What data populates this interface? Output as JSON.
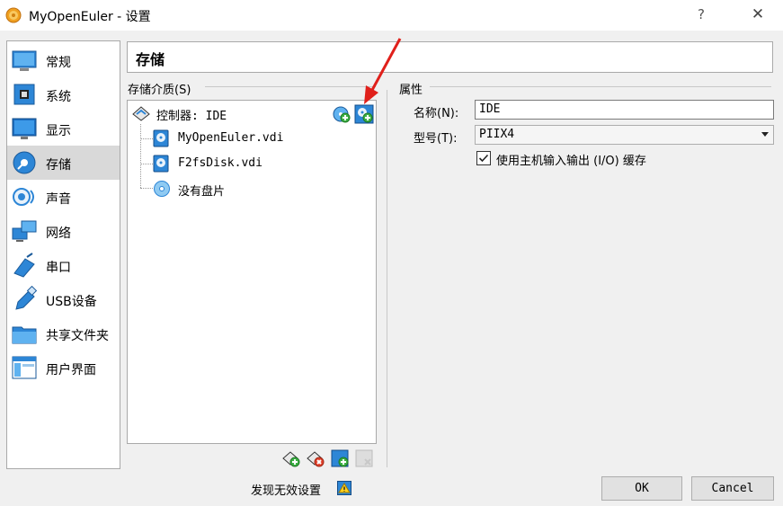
{
  "window": {
    "title": "MyOpenEuler - 设置",
    "help": "?",
    "close": "✕"
  },
  "sidebar": {
    "items": [
      {
        "label": "常规",
        "icon": "general-icon"
      },
      {
        "label": "系统",
        "icon": "system-chip-icon"
      },
      {
        "label": "显示",
        "icon": "display-monitor-icon"
      },
      {
        "label": "存储",
        "icon": "storage-disk-icon",
        "selected": true
      },
      {
        "label": "声音",
        "icon": "sound-speaker-icon"
      },
      {
        "label": "网络",
        "icon": "network-icon"
      },
      {
        "label": "串口",
        "icon": "serial-port-icon"
      },
      {
        "label": "USB设备",
        "icon": "usb-icon"
      },
      {
        "label": "共享文件夹",
        "icon": "shared-folder-icon"
      },
      {
        "label": "用户界面",
        "icon": "user-interface-icon"
      }
    ]
  },
  "header": {
    "title": "存储"
  },
  "storage": {
    "section_label": "存储介质(S)",
    "tree": {
      "controller": "控制器: IDE",
      "children": [
        {
          "label": "MyOpenEuler.vdi",
          "icon": "hard-disk-icon"
        },
        {
          "label": "F2fsDisk.vdi",
          "icon": "hard-disk-icon"
        },
        {
          "label": "没有盘片",
          "icon": "optical-disc-icon"
        }
      ]
    },
    "controller_actions": [
      "add-optical-drive-icon",
      "add-hard-disk-icon"
    ],
    "bottom_actions": [
      "add-controller-icon",
      "remove-controller-icon",
      "add-attachment-icon",
      "remove-attachment-icon"
    ]
  },
  "attributes": {
    "section_label": "属性",
    "name_label": "名称(N):",
    "name_value": "IDE",
    "type_label": "型号(T):",
    "type_value": "PIIX4",
    "cache_label": "使用主机输入输出 (I/O) 缓存",
    "cache_checked": true
  },
  "footer": {
    "invalid_settings": "发现无效设置",
    "ok": "OK",
    "cancel": "Cancel"
  },
  "colors": {
    "accent_blue": "#1e7fd0",
    "selection": "#d9d9d9",
    "annotation_arrow": "#e0201b"
  }
}
